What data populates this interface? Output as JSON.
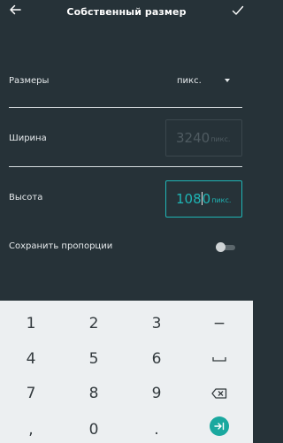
{
  "header": {
    "title": "Собственный размер"
  },
  "form": {
    "size_label": "Размеры",
    "units_value": "пикс.",
    "width_label": "Ширина",
    "width_value": "3240",
    "width_unit": "пикс.",
    "height_label": "Высота",
    "height_value_before_cursor": "108",
    "height_value_after_cursor": "0",
    "height_unit": "пикс.",
    "keep_ratio_label": "Сохранить пропорции",
    "keep_ratio_on": false
  },
  "keyboard": {
    "row1": [
      "1",
      "2",
      "3",
      "−"
    ],
    "row2": [
      "4",
      "5",
      "6",
      "space-icon"
    ],
    "row3": [
      "7",
      "8",
      "9",
      "backspace-icon"
    ],
    "row4": [
      ",",
      "0",
      ".",
      "enter-icon"
    ]
  },
  "colors": {
    "background": "#263238",
    "accent": "#1fb5b5",
    "keyboard_bg": "#eceff1",
    "enter_button": "#1aa89f"
  }
}
